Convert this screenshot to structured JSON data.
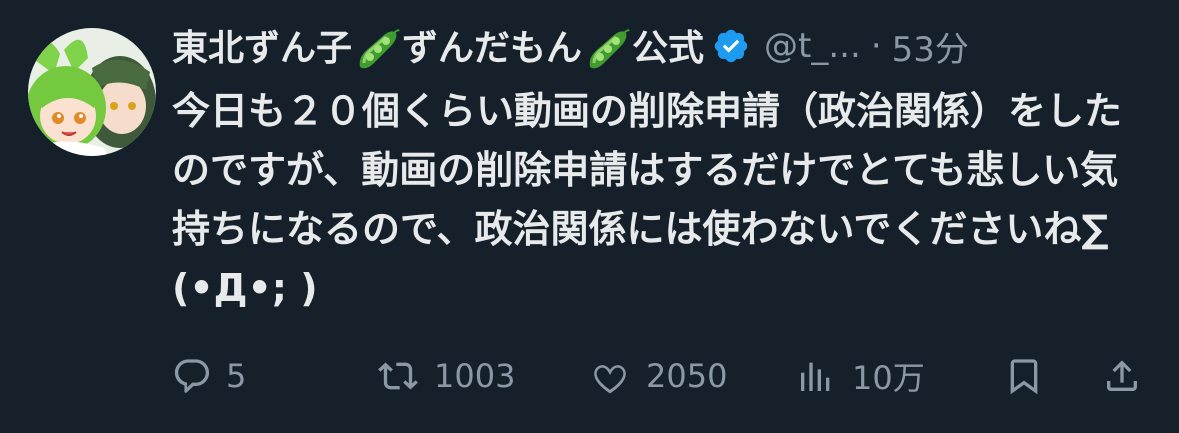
{
  "author": {
    "name_part1": "東北ずん子",
    "name_part2": "ずんだもん",
    "name_part3": "公式",
    "handle": "@t_...",
    "separator": "·",
    "time": "53分"
  },
  "tweet": {
    "text": "今日も２０個くらい動画の削除申請（政治関係）をしたのですが、動画の削除申請はするだけでとても悲しい気持ちになるので、政治関係には使わないでくださいね∑(•Д•; )"
  },
  "actions": {
    "reply_count": "5",
    "retweet_count": "1003",
    "like_count": "2050",
    "views_count": "10万"
  },
  "colors": {
    "background": "#15202b",
    "text": "#e7e9ea",
    "muted": "#8b98a5",
    "verified": "#1d9bf0"
  },
  "icons": [
    "pea-pod-icon",
    "verified-badge-icon",
    "reply-icon",
    "retweet-icon",
    "like-icon",
    "views-icon",
    "bookmark-icon",
    "share-icon"
  ]
}
